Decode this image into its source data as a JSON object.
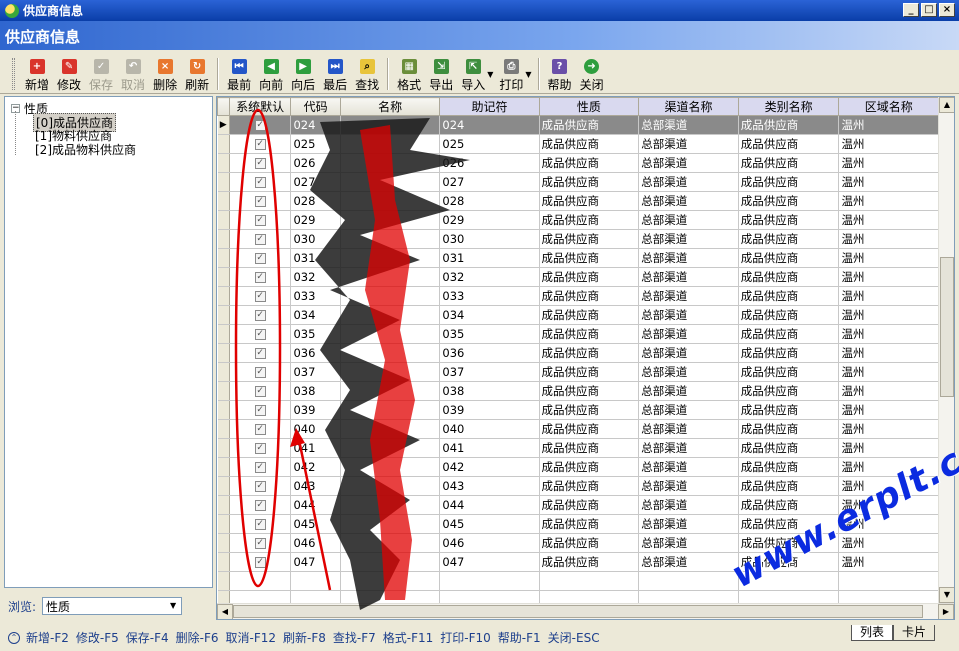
{
  "window": {
    "title": "供应商信息"
  },
  "header": {
    "title": "供应商信息"
  },
  "toolbar": {
    "new": "新增",
    "edit": "修改",
    "save": "保存",
    "cancel": "取消",
    "delete": "删除",
    "refresh": "刷新",
    "first": "最前",
    "prev": "向前",
    "next": "向后",
    "last": "最后",
    "find": "查找",
    "format": "格式",
    "export": "导出",
    "import": "导入",
    "print": "打印",
    "help": "帮助",
    "close": "关闭"
  },
  "tree": {
    "root": "性质",
    "children": [
      "[0]成品供应商",
      "[1]物料供应商",
      "[2]成品物料供应商"
    ]
  },
  "browse": {
    "label": "浏览:",
    "value": "性质"
  },
  "grid": {
    "columns": [
      "系统默认",
      "代码",
      "名称",
      "助记符",
      "性质",
      "渠道名称",
      "类别名称",
      "区域名称"
    ],
    "rows": [
      [
        "024",
        "024",
        "成品供应商",
        "总部渠道",
        "成品供应商",
        "温州"
      ],
      [
        "025",
        "025",
        "成品供应商",
        "总部渠道",
        "成品供应商",
        "温州"
      ],
      [
        "026",
        "026",
        "成品供应商",
        "总部渠道",
        "成品供应商",
        "温州"
      ],
      [
        "027",
        "027",
        "成品供应商",
        "总部渠道",
        "成品供应商",
        "温州"
      ],
      [
        "028",
        "028",
        "成品供应商",
        "总部渠道",
        "成品供应商",
        "温州"
      ],
      [
        "029",
        "029",
        "成品供应商",
        "总部渠道",
        "成品供应商",
        "温州"
      ],
      [
        "030",
        "030",
        "成品供应商",
        "总部渠道",
        "成品供应商",
        "温州"
      ],
      [
        "031",
        "031",
        "成品供应商",
        "总部渠道",
        "成品供应商",
        "温州"
      ],
      [
        "032",
        "032",
        "成品供应商",
        "总部渠道",
        "成品供应商",
        "温州"
      ],
      [
        "033",
        "033",
        "成品供应商",
        "总部渠道",
        "成品供应商",
        "温州"
      ],
      [
        "034",
        "034",
        "成品供应商",
        "总部渠道",
        "成品供应商",
        "温州"
      ],
      [
        "035",
        "035",
        "成品供应商",
        "总部渠道",
        "成品供应商",
        "温州"
      ],
      [
        "036",
        "036",
        "成品供应商",
        "总部渠道",
        "成品供应商",
        "温州"
      ],
      [
        "037",
        "037",
        "成品供应商",
        "总部渠道",
        "成品供应商",
        "温州"
      ],
      [
        "038",
        "038",
        "成品供应商",
        "总部渠道",
        "成品供应商",
        "温州"
      ],
      [
        "039",
        "039",
        "成品供应商",
        "总部渠道",
        "成品供应商",
        "温州"
      ],
      [
        "040",
        "040",
        "成品供应商",
        "总部渠道",
        "成品供应商",
        "温州"
      ],
      [
        "041",
        "041",
        "成品供应商",
        "总部渠道",
        "成品供应商",
        "温州"
      ],
      [
        "042",
        "042",
        "成品供应商",
        "总部渠道",
        "成品供应商",
        "温州"
      ],
      [
        "043",
        "043",
        "成品供应商",
        "总部渠道",
        "成品供应商",
        "温州"
      ],
      [
        "044",
        "044",
        "成品供应商",
        "总部渠道",
        "成品供应商",
        "温州"
      ],
      [
        "045",
        "045",
        "成品供应商",
        "总部渠道",
        "成品供应商",
        "温州"
      ],
      [
        "046",
        "046",
        "成品供应商",
        "总部渠道",
        "成品供应商",
        "温州"
      ],
      [
        "047",
        "047",
        "成品供应商",
        "总部渠道",
        "成品供应商",
        "温州"
      ]
    ]
  },
  "status": {
    "items": [
      "新增-F2",
      "修改-F5",
      "保存-F4",
      "删除-F6",
      "取消-F12",
      "刷新-F8",
      "查找-F7",
      "格式-F11",
      "打印-F10",
      "帮助-F1",
      "关闭-ESC"
    ]
  },
  "view_tabs": [
    "列表",
    "卡片"
  ],
  "watermark": "www.erplt.com",
  "colors": {
    "title_bar": "#0a3ea8",
    "header": "#2f66cf",
    "accent_red": "#e00000",
    "watermark": "#0b2be0"
  }
}
